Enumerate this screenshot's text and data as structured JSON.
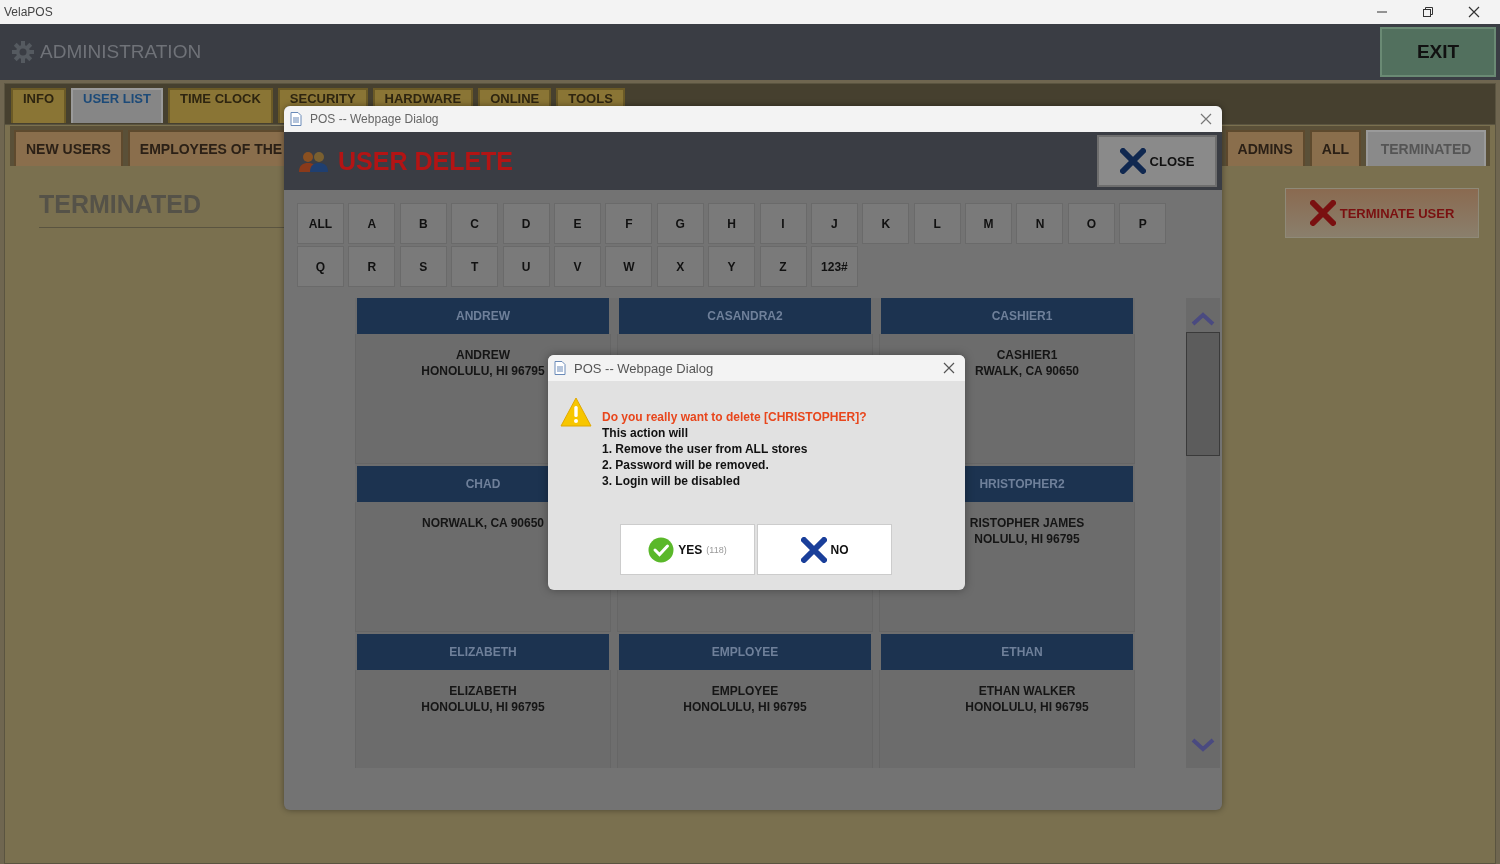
{
  "window": {
    "title": "VelaPOS"
  },
  "header": {
    "title": "ADMINISTRATION",
    "exit_button": "EXIT"
  },
  "tabs": [
    {
      "label": "INFO",
      "selected": false
    },
    {
      "label": "USER LIST",
      "selected": true
    },
    {
      "label": "TIME CLOCK",
      "selected": false
    },
    {
      "label": "SECURITY",
      "selected": false
    },
    {
      "label": "HARDWARE",
      "selected": false
    },
    {
      "label": "ONLINE",
      "selected": false
    },
    {
      "label": "TOOLS",
      "selected": false
    }
  ],
  "subtabs": [
    {
      "label": "NEW USERS",
      "selected": false
    },
    {
      "label": "EMPLOYEES OF THE",
      "selected": false
    },
    {
      "label": "ADMINS",
      "selected": false
    },
    {
      "label": "ALL",
      "selected": false
    },
    {
      "label": "TERMINATED",
      "selected": true
    }
  ],
  "section_title": "TERMINATED",
  "terminate_button": "TERMINATE USER",
  "user_dialog": {
    "title": "POS -- Webpage Dialog",
    "heading": "USER DELETE",
    "close_button": "CLOSE",
    "letters": [
      "ALL",
      "A",
      "B",
      "C",
      "D",
      "E",
      "F",
      "G",
      "H",
      "I",
      "J",
      "K",
      "L",
      "M",
      "N",
      "O",
      "P",
      "Q",
      "R",
      "S",
      "T",
      "U",
      "V",
      "W",
      "X",
      "Y",
      "Z",
      "123#"
    ],
    "cards": [
      {
        "kind": "user",
        "header": "ANDREW",
        "lines": [
          "ANDREW",
          "HONOLULU, HI 96795"
        ]
      },
      {
        "kind": "user",
        "header": "CASANDRA2"
      },
      {
        "kind": "user",
        "header": "CASHIER1",
        "lines": [
          "CASHIER1",
          "RWALK, CA 90650"
        ]
      },
      {
        "kind": "user",
        "header": "CHAD",
        "lines": [
          "NORWALK, CA 90650"
        ]
      },
      {
        "kind": "covered"
      },
      {
        "kind": "user",
        "header": "HRISTOPHER2",
        "lines": [
          "RISTOPHER JAMES",
          "NOLULU, HI 96795"
        ]
      },
      {
        "kind": "user",
        "header": "ELIZABETH",
        "lines": [
          "ELIZABETH",
          "HONOLULU, HI 96795"
        ]
      },
      {
        "kind": "user",
        "header": "EMPLOYEE",
        "lines": [
          "EMPLOYEE",
          "HONOLULU, HI 96795"
        ]
      },
      {
        "kind": "user",
        "header": "ETHAN",
        "lines": [
          "ETHAN WALKER",
          "HONOLULU, HI 96795"
        ]
      }
    ]
  },
  "confirm_dialog": {
    "title": "POS -- Webpage Dialog",
    "question": "Do you really want to delete [CHRISTOPHER]?",
    "lines": [
      "This action will",
      "1. Remove the user from ALL stores",
      "2. Password will be removed.",
      "3. Login will be disabled"
    ],
    "buttons": [
      {
        "kind": "yes",
        "label": "YES",
        "count": "(118)"
      },
      {
        "kind": "no",
        "label": "NO"
      }
    ]
  }
}
